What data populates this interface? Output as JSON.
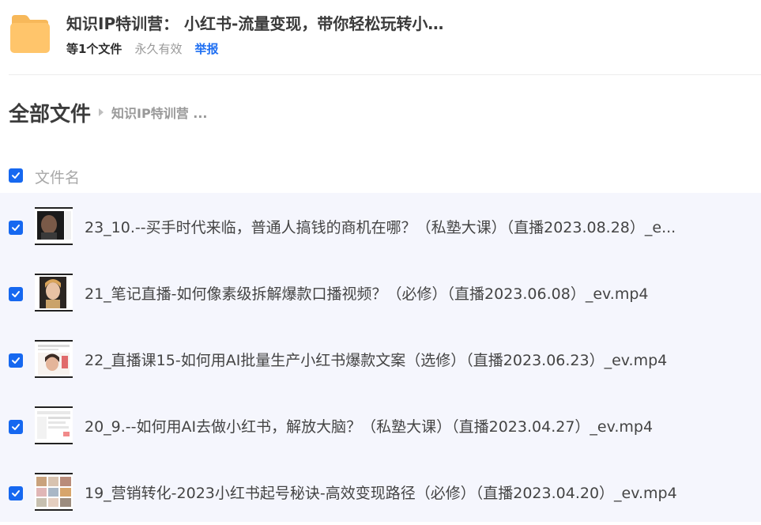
{
  "share": {
    "title": "知识IP特训营： 小红书-流量变现，带你轻松玩转小…",
    "file_count": "等1个文件",
    "validity": "永久有效",
    "report": "举报"
  },
  "breadcrumb": {
    "root": "全部文件",
    "current": "知识IP特训营 ..."
  },
  "list": {
    "column_name": "文件名",
    "header_checked": true,
    "files": [
      {
        "name": "23_10.--买手时代来临，普通人搞钱的商机在哪？（私塾大课）（直播2023.08.28）_e...",
        "checked": true,
        "thumb_icon": "video-thumbnail-icon"
      },
      {
        "name": "21_笔记直播-如何像素级拆解爆款口播视频？（必修）（直播2023.06.08）_ev.mp4",
        "checked": true,
        "thumb_icon": "video-thumbnail-icon"
      },
      {
        "name": "22_直播课15-如何用AI批量生产小红书爆款文案（选修）（直播2023.06.23）_ev.mp4",
        "checked": true,
        "thumb_icon": "video-thumbnail-icon"
      },
      {
        "name": "20_9.--如何用AI去做小红书，解放大脑？（私塾大课）（直播2023.04.27）_ev.mp4",
        "checked": true,
        "thumb_icon": "video-thumbnail-icon"
      },
      {
        "name": "19_营销转化-2023小红书起号秘诀-高效变现路径（必修）（直播2023.04.20）_ev.mp4",
        "checked": true,
        "thumb_icon": "video-thumbnail-icon"
      }
    ]
  },
  "colors": {
    "accent": "#1668f0",
    "link": "#1f6ff2",
    "folder": "#ffc56b",
    "list_bg": "#f5f6fd"
  }
}
